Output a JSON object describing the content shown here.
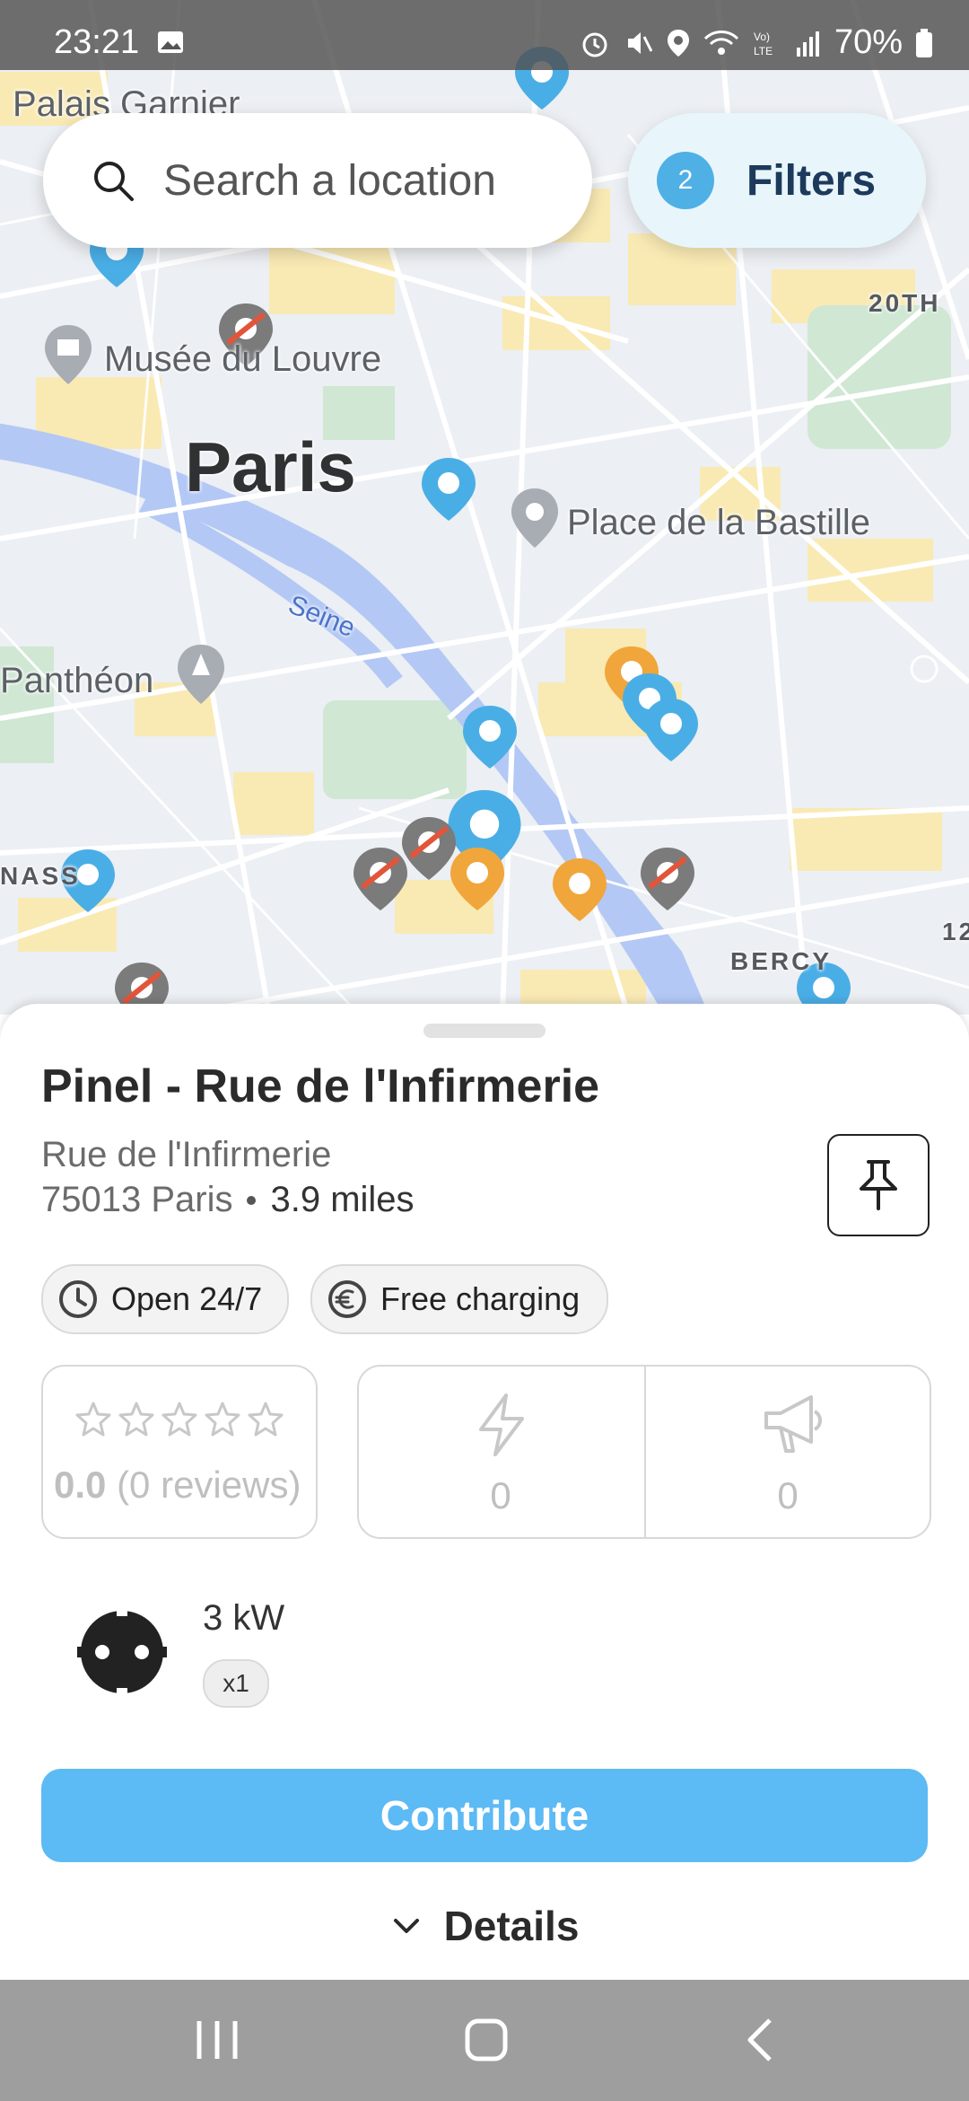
{
  "status_bar": {
    "time": "23:21",
    "battery": "70%"
  },
  "search": {
    "placeholder": "Search a location"
  },
  "filters": {
    "count": "2",
    "label": "Filters"
  },
  "map": {
    "labels": {
      "palais": "Palais Garnier",
      "louvre": "Musée du Louvre",
      "paris": "Paris",
      "bastille": "Place de la Bastille",
      "seine": "Seine",
      "pantheon": "Panthéon",
      "twentieth": "20TH",
      "bercy": "BERCY",
      "nass": "NASS",
      "twelve": "12"
    },
    "colors": {
      "available": "#4aaee6",
      "busy": "#f0a63a",
      "unavailable": "#7b7b7b",
      "water": "#b3c8f5",
      "blocks": "#fbe9ad"
    }
  },
  "station": {
    "title": "Pinel - Rue de l'Infirmerie",
    "street": "Rue de l'Infirmerie",
    "city": "75013 Paris",
    "distance": "3.9 miles",
    "chips": {
      "hours": "Open 24/7",
      "price": "Free charging"
    },
    "rating": {
      "value": "0.0",
      "reviews": "(0 reviews)"
    },
    "stats": {
      "charges": "0",
      "reports": "0"
    },
    "connector": {
      "power": "3 kW",
      "quantity": "x1"
    },
    "contribute_label": "Contribute",
    "details_label": "Details"
  }
}
